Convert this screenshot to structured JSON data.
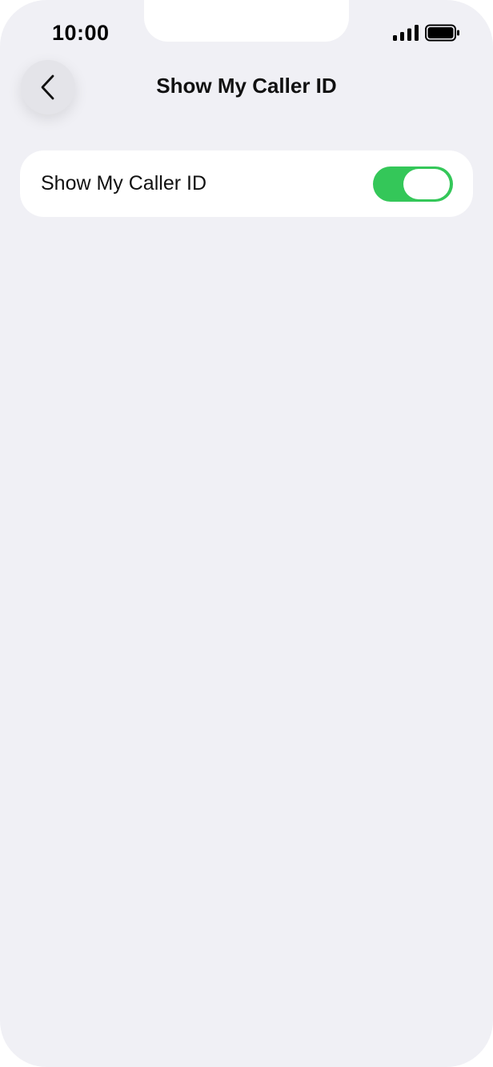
{
  "status_bar": {
    "time": "10:00",
    "signal_icon": "cellular-signal-icon",
    "battery_icon": "battery-icon"
  },
  "nav": {
    "back_icon": "chevron-left-icon",
    "title": "Show My Caller ID"
  },
  "settings": {
    "show_caller_id": {
      "label": "Show My Caller ID",
      "enabled": true
    }
  },
  "colors": {
    "background": "#f0f0f5",
    "card": "#ffffff",
    "toggle_on": "#34c759",
    "back_button": "#e4e4e9"
  }
}
